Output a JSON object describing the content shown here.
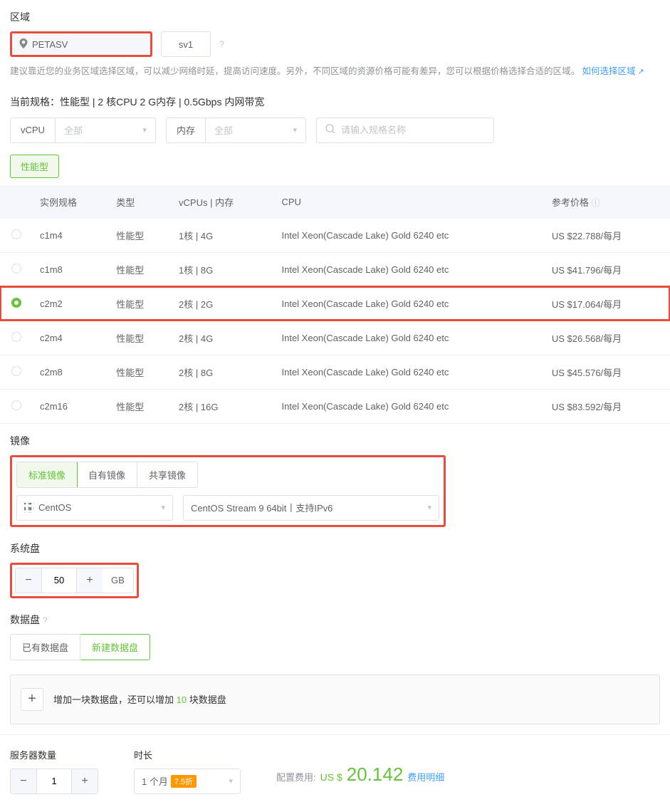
{
  "region": {
    "label": "区域",
    "selected": "PETASV",
    "alt": "sv1",
    "description": "建议靠近您的业务区域选择区域，可以减少网络时延，提高访问速度。另外，不同区域的资源价格可能有差异，您可以根据价格选择合适的区域。",
    "help_link": "如何选择区域"
  },
  "spec": {
    "summary_label": "当前规格：",
    "summary_value": "性能型 | 2 核CPU 2 G内存 | 0.5Gbps 内网带宽",
    "filters": {
      "vcpu_label": "vCPU",
      "vcpu_value": "全部",
      "mem_label": "内存",
      "mem_value": "全部",
      "search_placeholder": "请输入规格名称"
    },
    "tag": "性能型",
    "columns": {
      "c1": "实例规格",
      "c2": "类型",
      "c3": "vCPUs | 内存",
      "c4": "CPU",
      "c5": "参考价格"
    },
    "rows": [
      {
        "name": "c1m4",
        "type": "性能型",
        "vc": "1核 | 4G",
        "cpu": "Intel Xeon(Cascade Lake) Gold 6240 etc",
        "price": "US $22.788/每月",
        "sel": false,
        "hl": false
      },
      {
        "name": "c1m8",
        "type": "性能型",
        "vc": "1核 | 8G",
        "cpu": "Intel Xeon(Cascade Lake) Gold 6240 etc",
        "price": "US $41.796/每月",
        "sel": false,
        "hl": false
      },
      {
        "name": "c2m2",
        "type": "性能型",
        "vc": "2核 | 2G",
        "cpu": "Intel Xeon(Cascade Lake) Gold 6240 etc",
        "price": "US $17.064/每月",
        "sel": true,
        "hl": true
      },
      {
        "name": "c2m4",
        "type": "性能型",
        "vc": "2核 | 4G",
        "cpu": "Intel Xeon(Cascade Lake) Gold 6240 etc",
        "price": "US $26.568/每月",
        "sel": false,
        "hl": false
      },
      {
        "name": "c2m8",
        "type": "性能型",
        "vc": "2核 | 8G",
        "cpu": "Intel Xeon(Cascade Lake) Gold 6240 etc",
        "price": "US $45.576/每月",
        "sel": false,
        "hl": false
      },
      {
        "name": "c2m16",
        "type": "性能型",
        "vc": "2核 | 16G",
        "cpu": "Intel Xeon(Cascade Lake) Gold 6240 etc",
        "price": "US $83.592/每月",
        "sel": false,
        "hl": false
      }
    ]
  },
  "image": {
    "label": "镜像",
    "tabs": {
      "t1": "标准镜像",
      "t2": "自有镜像",
      "t3": "共享镜像"
    },
    "os": "CentOS",
    "version": "CentOS Stream 9 64bit丨支持IPv6"
  },
  "sysdisk": {
    "label": "系统盘",
    "value": "50",
    "unit": "GB"
  },
  "datadisk": {
    "label": "数据盘",
    "tabs": {
      "t1": "已有数据盘",
      "t2": "新建数据盘"
    },
    "add_text_a": "增加一块数据盘，还可以增加 ",
    "add_count": "10",
    "add_text_b": " 块数据盘"
  },
  "footer": {
    "qty_label": "服务器数量",
    "qty": "1",
    "dur_label": "时长",
    "dur_value": "1 个月",
    "discount": "7.5折",
    "cost_label": "配置费用:",
    "cost_cur": "US $",
    "cost_amt": "20.142",
    "detail": "费用明细"
  }
}
